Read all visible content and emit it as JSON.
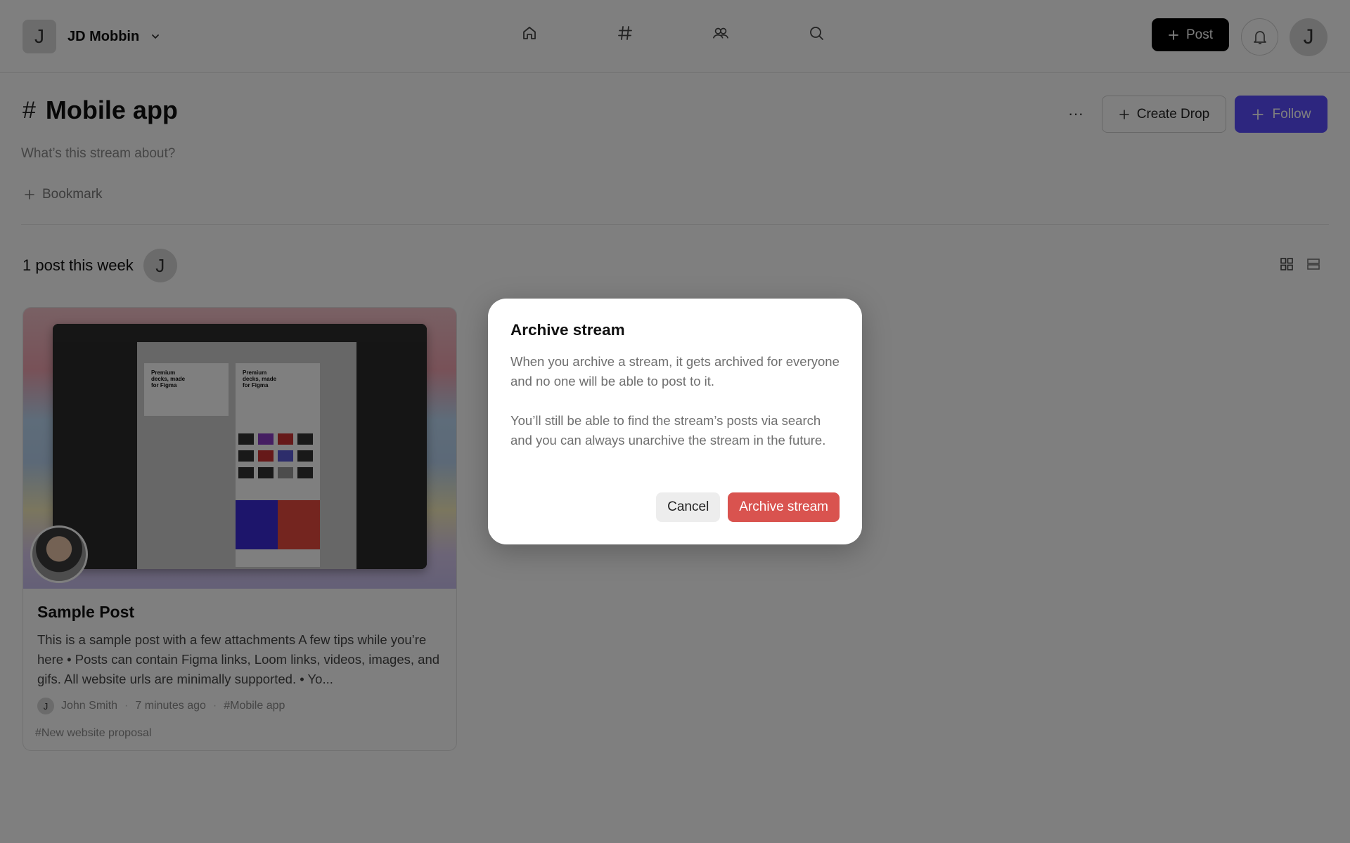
{
  "header": {
    "org_initial": "J",
    "org_name": "JD Mobbin",
    "post_label": "Post",
    "user_initial": "J",
    "nav_icons": [
      "home-icon",
      "hashtag-icon",
      "people-icon",
      "search-icon"
    ]
  },
  "stream": {
    "hash": "#",
    "title": "Mobile app",
    "description_placeholder": "What’s this stream about?",
    "bookmark_label": "Bookmark",
    "create_drop_label": "Create Drop",
    "follow_label": "Follow",
    "more_label": "···"
  },
  "feed": {
    "week_summary": "1 post this week",
    "week_avatar_initial": "J"
  },
  "post": {
    "title": "Sample Post",
    "text": "This is a sample post with a few attachments A few tips while you’re here • Posts can contain Figma links, Loom links, videos, images, and gifs. All website urls are minimally supported. • Yo...",
    "author_initial": "J",
    "author": "John Smith",
    "time": "7 minutes ago",
    "stream_tag": "#Mobile app",
    "project_tag": "#New website proposal",
    "sep": "·"
  },
  "modal": {
    "title": "Archive stream",
    "paragraph1": "When you archive a stream, it gets archived for everyone and no one will be able to post to it.",
    "paragraph2": "You’ll still be able to find the stream’s posts via search and you can always unarchive the stream in the future.",
    "cancel_label": "Cancel",
    "confirm_label": "Archive stream"
  },
  "colors": {
    "follow": "#5b4dff",
    "danger": "#d9534f",
    "overlay": "rgba(0,0,0,0.5)"
  }
}
